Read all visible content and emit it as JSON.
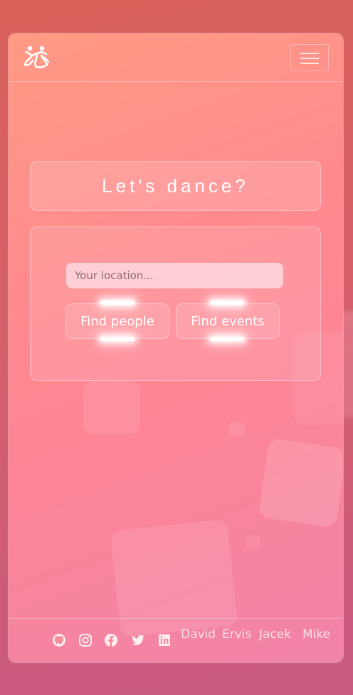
{
  "app": {
    "logo_icon": "dancers-logo-icon",
    "menu_icon": "hamburger-menu-icon"
  },
  "hero": {
    "title": "Let's dance?"
  },
  "search": {
    "placeholder": "Your location...",
    "value": "",
    "find_people_label": "Find people",
    "find_events_label": "Find events"
  },
  "footer": {
    "social_icons": [
      "github-icon",
      "instagram-icon",
      "facebook-icon",
      "twitter-icon",
      "linkedin-icon"
    ],
    "authors": [
      "David",
      "Ervis",
      "Jacek",
      "Mike"
    ]
  },
  "colors": {
    "accent_light": "#ff9a84",
    "accent_mid": "#fd8596",
    "background_dark": "#d6606a"
  }
}
